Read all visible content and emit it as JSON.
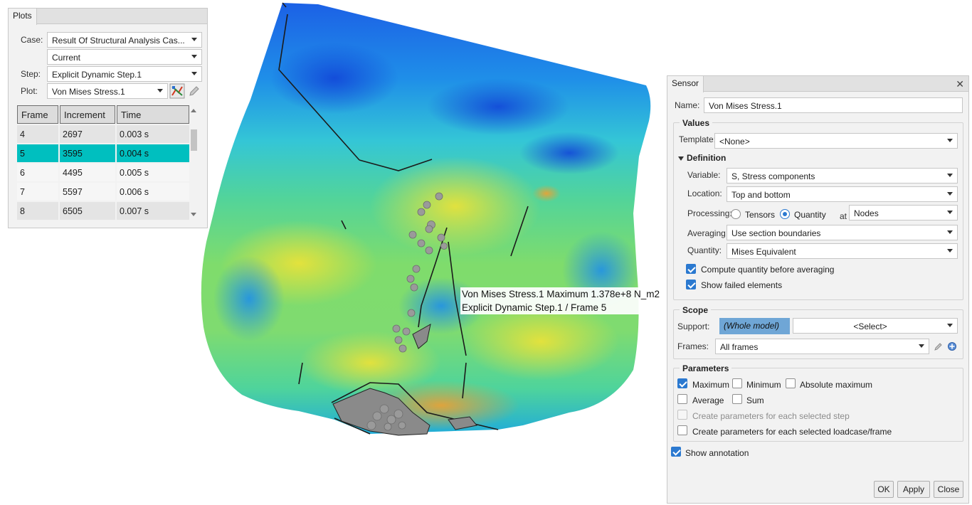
{
  "plots_panel": {
    "tab": "Plots",
    "case_label": "Case:",
    "case_value": "Result Of Structural Analysis Cas...",
    "case_sub_value": "Current",
    "step_label": "Step:",
    "step_value": "Explicit Dynamic Step.1",
    "plot_label": "Plot:",
    "plot_value": "Von Mises Stress.1",
    "table": {
      "headers": [
        "Frame",
        "Increment",
        "Time"
      ],
      "rows": [
        [
          "4",
          "2697",
          "0.003 s"
        ],
        [
          "5",
          "3595",
          "0.004 s"
        ],
        [
          "6",
          "4495",
          "0.005 s"
        ],
        [
          "7",
          "5597",
          "0.006 s"
        ],
        [
          "8",
          "6505",
          "0.007 s"
        ]
      ],
      "selected_frame": "5"
    }
  },
  "viewport": {
    "annotation_line1": "Von Mises Stress.1 Maximum 1.378e+8 N_m2",
    "annotation_line2": "Explicit Dynamic Step.1 / Frame 5"
  },
  "sensor_panel": {
    "tab": "Sensor",
    "name_label": "Name:",
    "name_value": "Von Mises Stress.1",
    "values_group": "Values",
    "template_label": "Template:",
    "template_value": "<None>",
    "definition_group": "Definition",
    "variable_label": "Variable:",
    "variable_value": "S, Stress components",
    "location_label": "Location:",
    "location_value": "Top and bottom",
    "processing_label": "Processing:",
    "processing_tensors": "Tensors",
    "processing_quantity": "Quantity",
    "processing_selected": "Quantity",
    "at_label": "at",
    "at_value": "Nodes",
    "averaging_label": "Averaging:",
    "averaging_value": "Use section boundaries",
    "quantity_label": "Quantity:",
    "quantity_value": "Mises Equivalent",
    "compute_before_averaging": "Compute quantity before averaging",
    "show_failed": "Show failed elements",
    "scope_group": "Scope",
    "support_label": "Support:",
    "support_value": "(Whole model)",
    "support_select": "<Select>",
    "frames_label": "Frames:",
    "frames_value": "All frames",
    "parameters_group": "Parameters",
    "param_maximum": "Maximum",
    "param_minimum": "Minimum",
    "param_absolute_maximum": "Absolute maximum",
    "param_average": "Average",
    "param_sum": "Sum",
    "param_each_step": "Create parameters for each selected step",
    "param_each_loadcase": "Create parameters for each selected loadcase/frame",
    "show_annotation": "Show annotation",
    "ok_label": "OK",
    "apply_label": "Apply",
    "close_label": "Close"
  },
  "colors": {
    "selection": "#00bfbf",
    "accent": "#2b79d0",
    "whole_model_highlight": "#6fa6d6"
  }
}
